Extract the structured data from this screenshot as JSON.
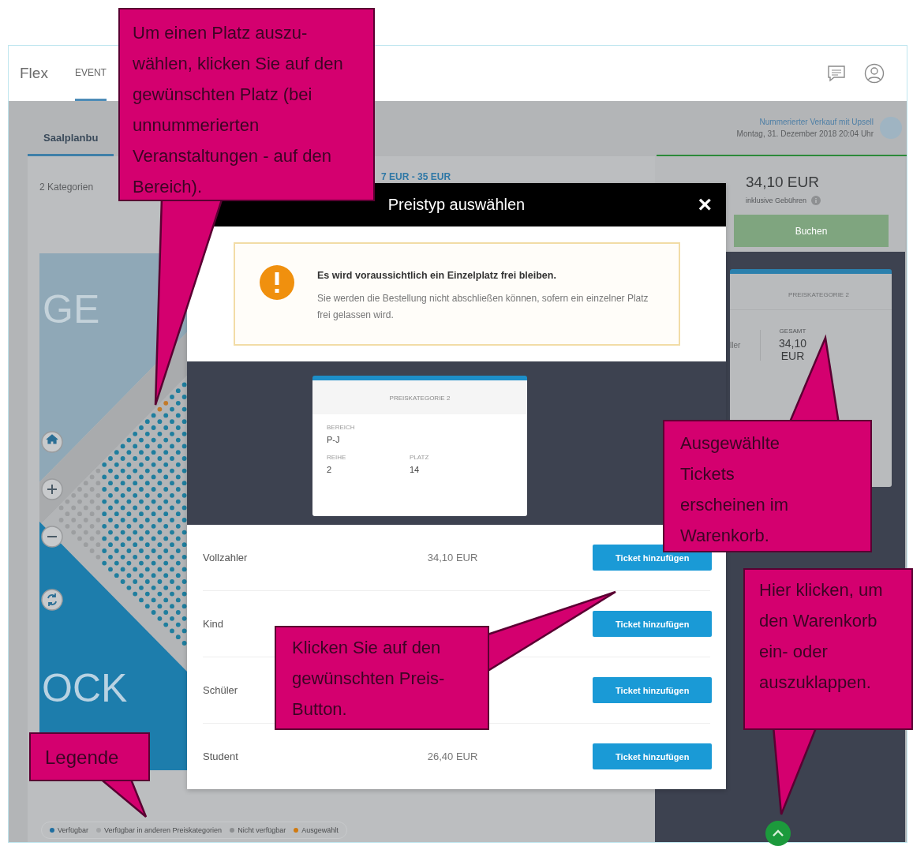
{
  "header": {
    "logo": "Flex",
    "nav": [
      {
        "label": "EVENT",
        "selected": true
      }
    ]
  },
  "subheader": {
    "tabs": [
      {
        "label": "Saalplanbu",
        "selected": true
      }
    ],
    "event_name": "Nummerierter Verkauf mit Upsell",
    "event_date": "Montag, 31. Dezember 2018 20:04 Uhr"
  },
  "seat_plan": {
    "categories": "2 Kategorien",
    "price_range": "7 EUR - 35 EUR",
    "map_labels": [
      "GE",
      "OCK"
    ],
    "legend": [
      {
        "label": "Verfügbar",
        "color": "#1f6ea0"
      },
      {
        "label": "Verfügbar in anderen Preiskategorien",
        "color": "#a3a5a7"
      },
      {
        "label": "Nicht verfügbar",
        "color": "#8c8e90"
      },
      {
        "label": "Ausgewählt",
        "color": "#d07a10"
      }
    ]
  },
  "cart": {
    "total": "34,10 EUR",
    "fee_note": "inklusive Gebühren",
    "book_button": "Buchen",
    "ticket": {
      "category": "PREISKATEGORIE 2",
      "price_type": "ller",
      "total_label": "GESAMT",
      "total": "34,10 EUR"
    }
  },
  "modal": {
    "title": "Preistyp auswählen",
    "close": "×",
    "warning": {
      "title": "Es wird voraussichtlich ein Einzelplatz frei bleiben.",
      "text": "Sie werden die Bestellung nicht abschließen können, sofern ein einzelner Platz frei gelassen wird."
    },
    "ticket": {
      "category": "PREISKATEGORIE 2",
      "fields": [
        {
          "label": "BEREICH",
          "value": "P-J"
        },
        {
          "label": "REIHE",
          "value": "2"
        },
        {
          "label": "PLATZ",
          "value": "14"
        }
      ]
    },
    "price_types": [
      {
        "name": "Vollzahler",
        "price": "34,10 EUR",
        "button": "Ticket hinzufügen"
      },
      {
        "name": "Kind",
        "button": "Ticket hinzufügen"
      },
      {
        "name": "Schüler",
        "button": "Ticket hinzufügen"
      },
      {
        "name": "Student",
        "price": "26,40 EUR",
        "button": "Ticket hinzufügen"
      }
    ]
  },
  "callouts": [
    {
      "text": "Um einen Platz auszu- wählen, klicken Sie auf den gewünschten Platz (bei unnummerierten Veranstaltungen - auf den Bereich)."
    },
    {
      "text": "Ausgewählte Tickets erscheinen im Warenkorb."
    },
    {
      "text": "Hier klicken, um den Warenkorb ein- oder auszuklappen."
    },
    {
      "text": "Klicken Sie auf den gewünschten Preis-Button."
    },
    {
      "text": "Legende"
    }
  ]
}
